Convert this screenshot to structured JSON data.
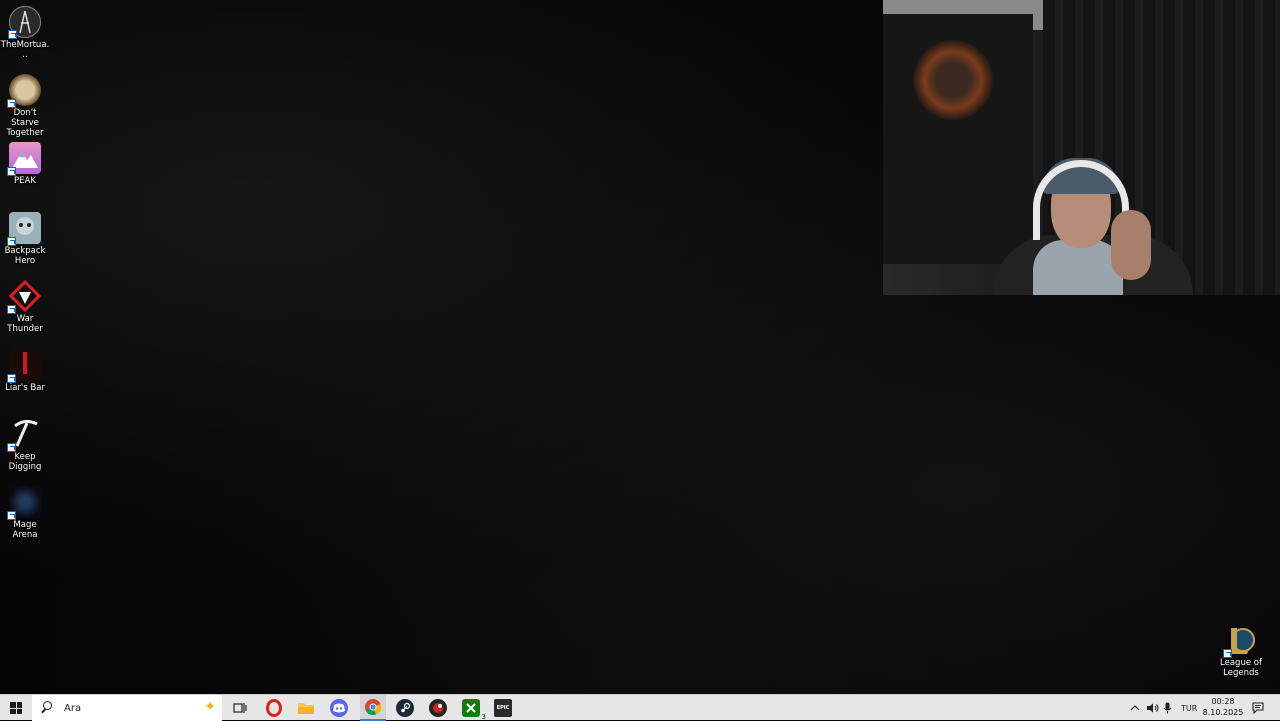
{
  "desktop": {
    "icons": [
      {
        "label": "TheMortua..."
      },
      {
        "label": "Don't Starve Together"
      },
      {
        "label": "PEAK"
      },
      {
        "label": "Backpack Hero"
      },
      {
        "label": "War Thunder"
      },
      {
        "label": "Liar's Bar"
      },
      {
        "label": "Keep Digging"
      },
      {
        "label": "Mage Arena"
      },
      {
        "label": "League of Legends"
      }
    ]
  },
  "taskbar": {
    "search_placeholder": "Ara",
    "apps": [
      "opera-icon",
      "file-explorer-icon",
      "discord-icon",
      "chrome-icon",
      "steam-icon",
      "app-red-icon",
      "xbox-icon",
      "epic-games-icon"
    ],
    "xbox_badge": "3",
    "epic_label": "EPIC",
    "tray": {
      "language": "TUR",
      "time": "00:28",
      "date": "8.10.2025"
    }
  },
  "colors": {
    "taskbar_bg": "#e6e6e6",
    "opera": "#e0201b",
    "discord": "#5865f2",
    "steam": "#1b2838",
    "xbox": "#107c10"
  }
}
